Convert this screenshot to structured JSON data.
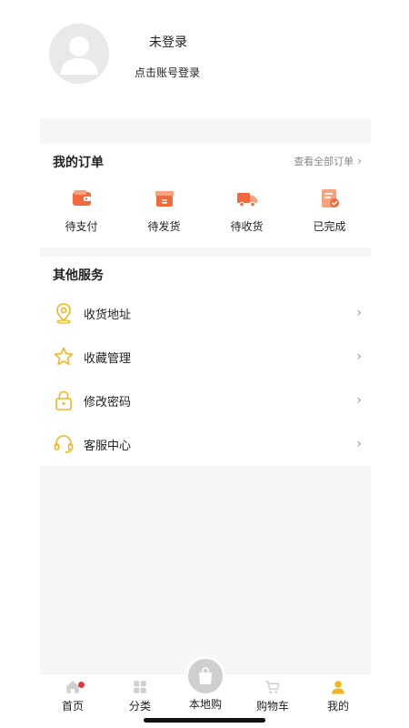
{
  "profile": {
    "status": "未登录",
    "hint": "点击账号登录"
  },
  "orders": {
    "title": "我的订单",
    "view_all": "查看全部订单",
    "items": [
      {
        "label": "待支付",
        "icon": "wallet-icon"
      },
      {
        "label": "待发货",
        "icon": "box-icon"
      },
      {
        "label": "待收货",
        "icon": "truck-icon"
      },
      {
        "label": "已完成",
        "icon": "completed-doc-icon"
      }
    ]
  },
  "services": {
    "title": "其他服务",
    "items": [
      {
        "label": "收货地址",
        "icon": "location-pin-icon"
      },
      {
        "label": "收藏管理",
        "icon": "star-icon"
      },
      {
        "label": "修改密码",
        "icon": "lock-icon"
      },
      {
        "label": "客服中心",
        "icon": "headset-icon"
      }
    ]
  },
  "tabbar": {
    "items": [
      {
        "label": "首页",
        "icon": "home-icon",
        "has_badge": true
      },
      {
        "label": "分类",
        "icon": "grid-icon"
      },
      {
        "label": "本地购",
        "icon": "shopping-bag-icon"
      },
      {
        "label": "购物车",
        "icon": "cart-icon"
      },
      {
        "label": "我的",
        "icon": "user-icon",
        "active": true
      }
    ]
  },
  "colors": {
    "accent_orange": "#f26a3c",
    "accent_yellow": "#f2b61c",
    "badge_red": "#e23b3b",
    "panel_gray": "#f6f6f7"
  }
}
